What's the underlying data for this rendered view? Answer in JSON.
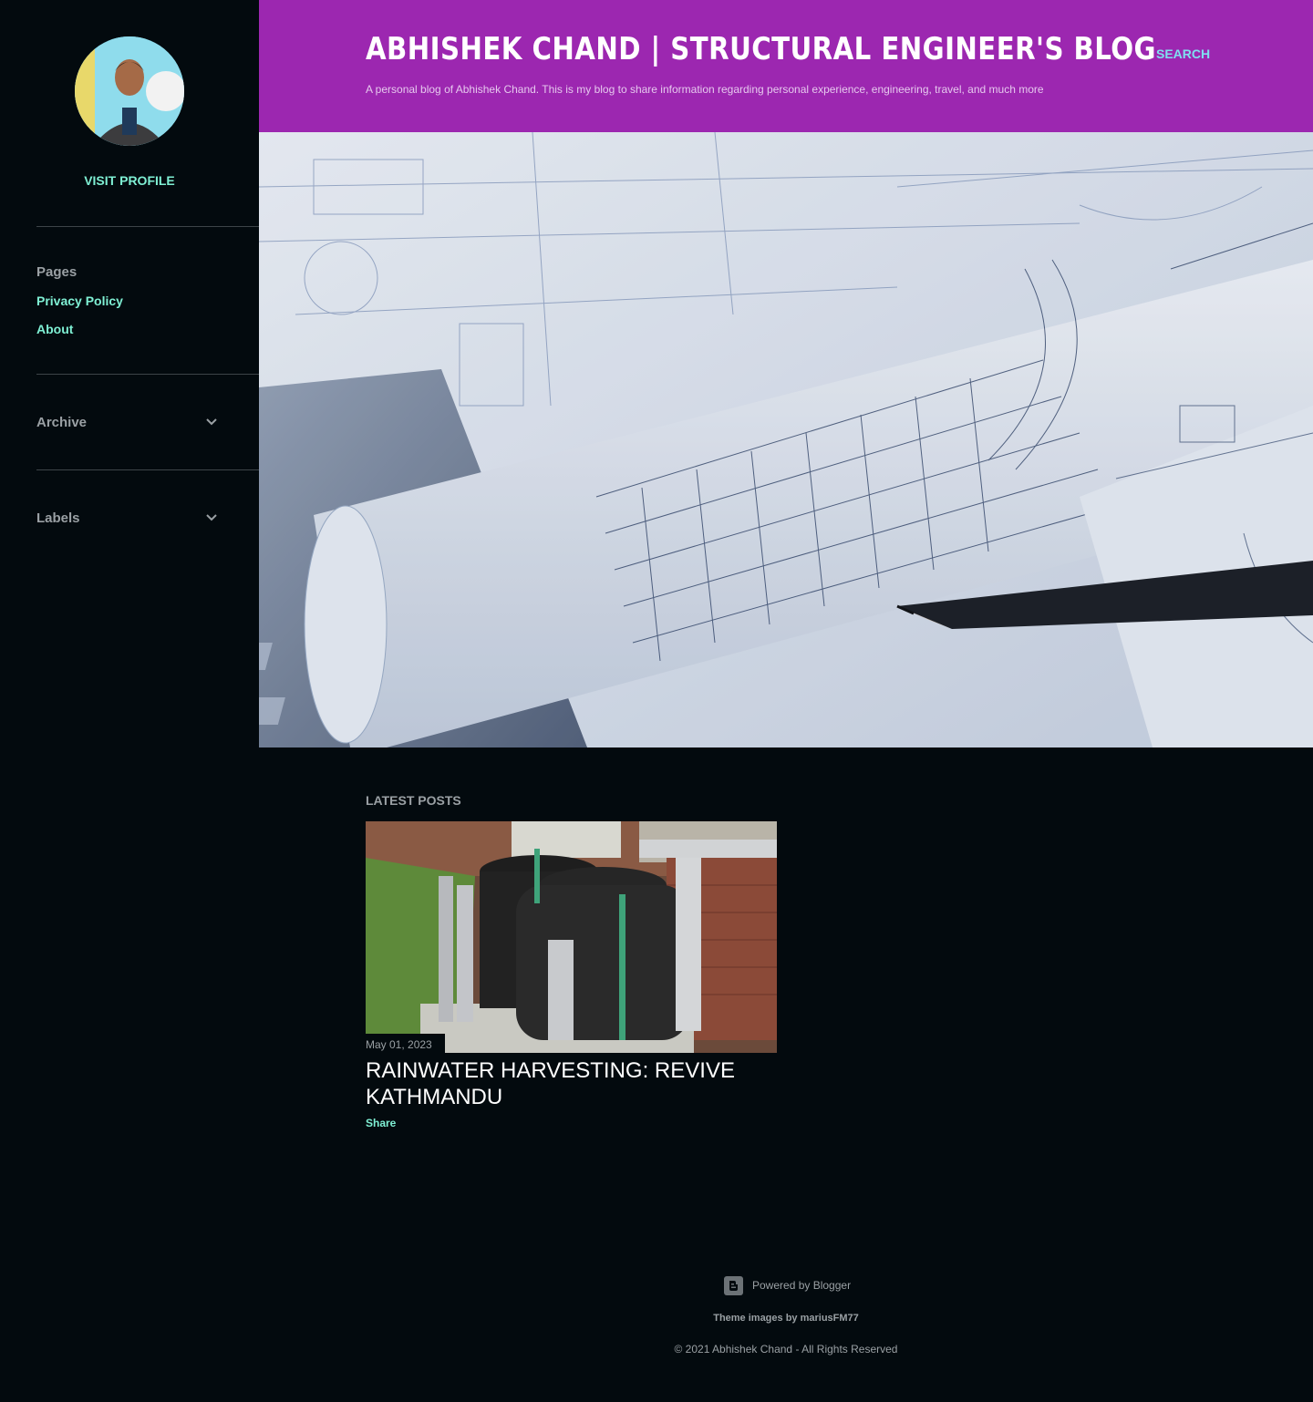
{
  "sidebar": {
    "visit_profile": "Visit profile",
    "pages_title": "Pages",
    "pages": [
      {
        "label": "Privacy Policy"
      },
      {
        "label": "About"
      }
    ],
    "archive_title": "Archive",
    "labels_title": "Labels"
  },
  "header": {
    "title": "ABHISHEK CHAND | STRUCTURAL ENGINEER'S BLOG",
    "description": "A personal blog of Abhishek Chand. This is my blog to share information regarding personal experience, engineering, travel, and much more",
    "search_label": "Search"
  },
  "main": {
    "section_title": "Latest posts",
    "posts": [
      {
        "date": "May 01, 2023",
        "title": "Rainwater harvesting: Revive Kathmandu",
        "share_label": "Share"
      }
    ]
  },
  "footer": {
    "powered_by": "Powered by Blogger",
    "theme_credit": "Theme images by mariusFM77",
    "copyright": "© 2021 Abhishek Chand - All Rights Reserved"
  },
  "colors": {
    "header_bg": "#9c27b0",
    "page_bg": "#030a0e",
    "accent": "#7ff0d4",
    "muted_text": "#9aa0a4"
  },
  "icons": [
    "avatar",
    "chevron-down-icon",
    "blogger-icon"
  ]
}
